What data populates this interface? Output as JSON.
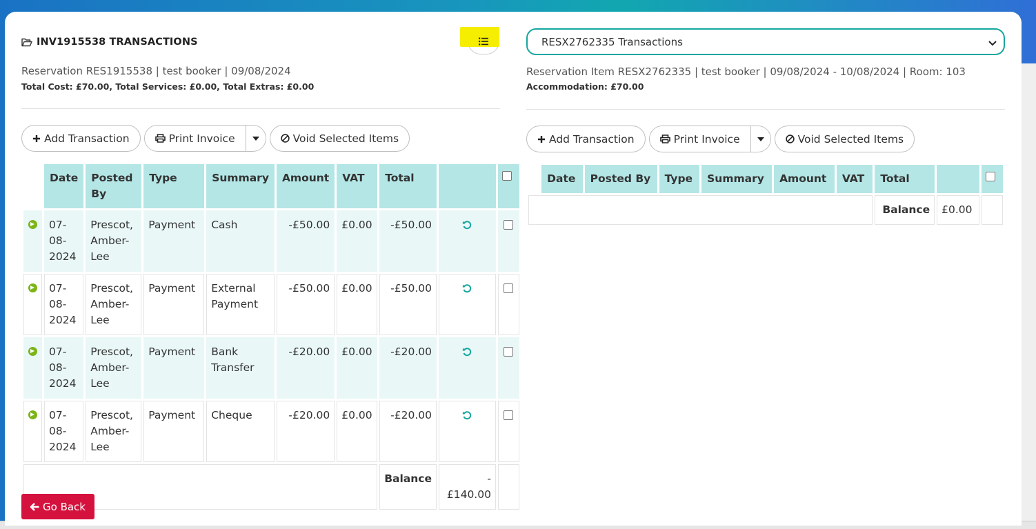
{
  "left": {
    "title": "INV1915538 TRANSACTIONS",
    "info_line": "Reservation RES1915538 | test booker | 09/08/2024",
    "cost_line": "Total Cost: £70.00, Total Services: £0.00, Total Extras: £0.00",
    "toolbar": {
      "add": "Add Transaction",
      "print": "Print Invoice",
      "void": "Void Selected Items"
    },
    "columns": [
      "Date",
      "Posted By",
      "Type",
      "Summary",
      "Amount",
      "VAT",
      "Total"
    ],
    "rows": [
      {
        "date": "07-08-2024",
        "posted_by": "Prescot, Amber-Lee",
        "type": "Payment",
        "summary": "Cash",
        "amount": "-£50.00",
        "vat": "£0.00",
        "total": "-£50.00"
      },
      {
        "date": "07-08-2024",
        "posted_by": "Prescot, Amber-Lee",
        "type": "Payment",
        "summary": "External Payment",
        "amount": "-£50.00",
        "vat": "£0.00",
        "total": "-£50.00"
      },
      {
        "date": "07-08-2024",
        "posted_by": "Prescot, Amber-Lee",
        "type": "Payment",
        "summary": "Bank Transfer",
        "amount": "-£20.00",
        "vat": "£0.00",
        "total": "-£20.00"
      },
      {
        "date": "07-08-2024",
        "posted_by": "Prescot, Amber-Lee",
        "type": "Payment",
        "summary": "Cheque",
        "amount": "-£20.00",
        "vat": "£0.00",
        "total": "-£20.00"
      }
    ],
    "balance_label": "Balance",
    "balance_value": "-£140.00"
  },
  "right": {
    "select_value": "RESX2762335 Transactions",
    "info_line": "Reservation Item RESX2762335 | test booker | 09/08/2024 - 10/08/2024 | Room: 103",
    "cost_line": "Accommodation: £70.00",
    "toolbar": {
      "add": "Add Transaction",
      "print": "Print Invoice",
      "void": "Void Selected Items"
    },
    "columns": [
      "Date",
      "Posted By",
      "Type",
      "Summary",
      "Amount",
      "VAT",
      "Total"
    ],
    "balance_label": "Balance",
    "balance_value": "£0.00"
  },
  "go_back": "Go Back",
  "icons": {
    "title": "folder-open-icon",
    "toggle": "list-icon",
    "add": "plus-icon",
    "print": "printer-icon",
    "void": "ban-icon",
    "row_action": "arrow-circle-right-icon",
    "refund": "undo-icon",
    "back": "arrow-left-icon"
  },
  "colors": {
    "accent": "#15a69f",
    "header_bg": "#b4e6e6",
    "row_shade": "#e9f7f7",
    "danger": "#d5123e",
    "highlight": "#f5ee00",
    "go_icon": "#7cb518"
  }
}
